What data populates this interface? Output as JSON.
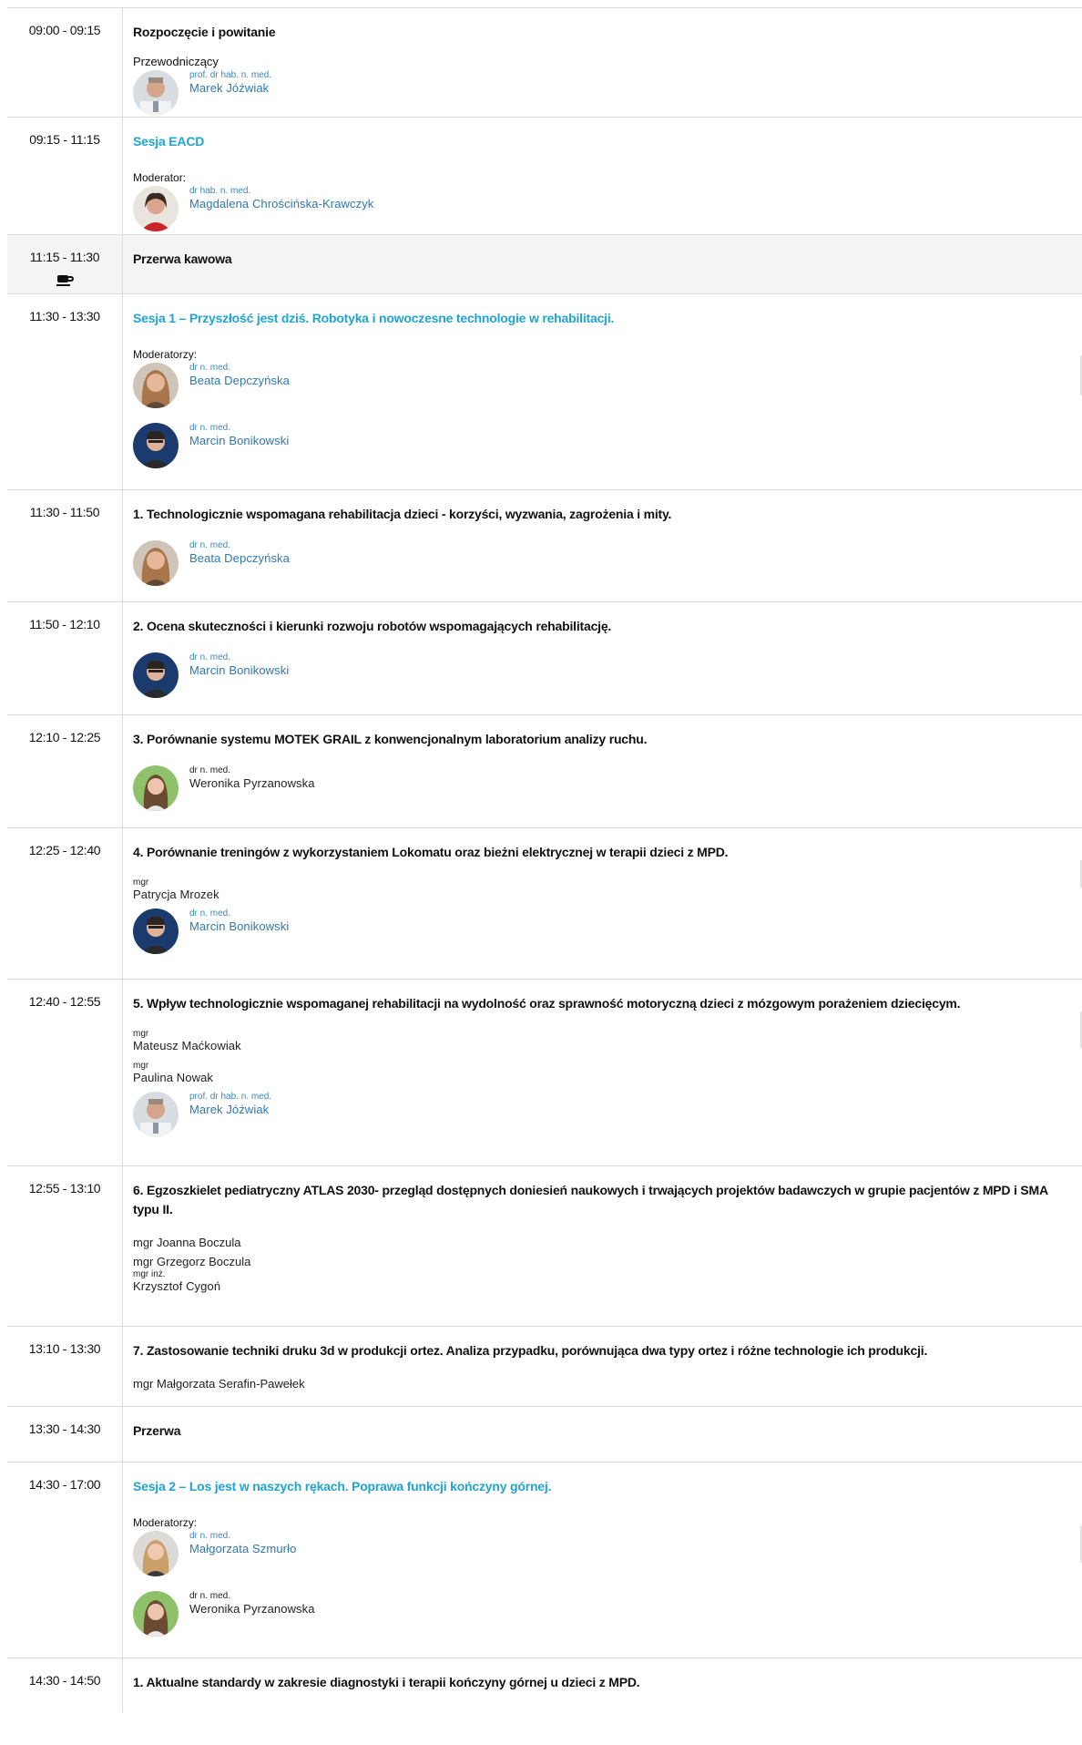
{
  "rows": {
    "r0": {
      "time": "09:00 - 09:15",
      "title": "Rozpoczęcie i powitanie",
      "role": "Przewodniczący",
      "p1": {
        "deg": "prof. dr hab. n. med.",
        "name": "Marek Jóźwiak"
      }
    },
    "r1": {
      "time": "09:15 - 11:15",
      "title": "Sesja EACD",
      "role": "Moderator:",
      "p1": {
        "deg": "dr hab. n. med.",
        "name": "Magdalena Chrościńska-Krawczyk"
      }
    },
    "r2": {
      "time": "11:15 - 11:30",
      "title": "Przerwa kawowa",
      "icon": "coffee-cup-icon"
    },
    "r3": {
      "time": "11:30 - 13:30",
      "title": "Sesja 1 – Przyszłość jest dziś. Robotyka i nowoczesne technologie w rehabilitacji.",
      "role": "Moderatorzy:",
      "p1": {
        "deg": "dr n. med.",
        "name": "Beata Depczyńska"
      },
      "p2": {
        "deg": "dr n. med.",
        "name": "Marcin Bonikowski"
      }
    },
    "r4": {
      "time": "11:30 - 11:50",
      "title": "1. Technologicznie wspomagana rehabilitacja dzieci - korzyści, wyzwania, zagrożenia i mity.",
      "p1": {
        "deg": "dr n. med.",
        "name": "Beata Depczyńska"
      }
    },
    "r5": {
      "time": "11:50 - 12:10",
      "title": "2. Ocena skuteczności i kierunki rozwoju robotów wspomagających rehabilitację.",
      "p1": {
        "deg": "dr n. med.",
        "name": "Marcin Bonikowski"
      }
    },
    "r6": {
      "time": "12:10 - 12:25",
      "title": "3. Porównanie systemu MOTEK GRAIL z konwencjonalnym laboratorium analizy ruchu.",
      "p1": {
        "deg": "dr n. med.",
        "name": "Weronika Pyrzanowska"
      }
    },
    "r7": {
      "time": "12:25 - 12:40",
      "title": "4. Porównanie treningów z wykorzystaniem Lokomatu oraz bieżni elektrycznej w terapii dzieci z MPD.",
      "t1": {
        "deg": "mgr",
        "name": "Patrycja Mrozek"
      },
      "p1": {
        "deg": "dr n. med.",
        "name": "Marcin Bonikowski"
      }
    },
    "r8": {
      "time": "12:40 - 12:55",
      "title": "5. Wpływ technologicznie wspomaganej rehabilitacji na wydolność oraz sprawność motoryczną dzieci z mózgowym porażeniem dziecięcym.",
      "t1": {
        "deg": "mgr",
        "name": "Mateusz Maćkowiak"
      },
      "t2": {
        "deg": "mgr",
        "name": "Paulina Nowak"
      },
      "p1": {
        "deg": "prof. dr hab. n. med.",
        "name": "Marek Jóźwiak"
      }
    },
    "r9": {
      "time": "12:55 - 13:10",
      "title": "6. Egzoszkielet pediatryczny ATLAS 2030- przegląd dostępnych doniesień naukowych i trwających projektów badawczych w grupie pacjentów z MPD i SMA typu II.",
      "s1": "mgr Joanna Boczula",
      "s2": "mgr Grzegorz Boczula",
      "t1": {
        "deg": "mgr inż.",
        "name": "Krzysztof Cygoń"
      }
    },
    "r10": {
      "time": "13:10 - 13:30",
      "title": "7. Zastosowanie techniki druku 3d w produkcji ortez. Analiza przypadku, porównująca dwa typy ortez i różne technologie ich produkcji.",
      "s1": "mgr Małgorzata Serafin-Pawełek"
    },
    "r11": {
      "time": "13:30 - 14:30",
      "title": "Przerwa"
    },
    "r12": {
      "time": "14:30 - 17:00",
      "title": "Sesja 2 – Los jest w naszych rękach. Poprawa funkcji kończyny górnej.",
      "role": "Moderatorzy:",
      "p1": {
        "deg": "dr n. med.",
        "name": "Małgorzata Szmurło"
      },
      "p2": {
        "deg": "dr n. med.",
        "name": "Weronika Pyrzanowska"
      }
    },
    "r13": {
      "time": "14:30 - 14:50",
      "title": "1. Aktualne standardy w zakresie diagnostyki i terapii kończyny górnej u dzieci z MPD."
    }
  },
  "colors": {
    "link": "#1fa4d3",
    "name": "#2f77b0",
    "border": "#dcdcdc",
    "break_bg": "#f4f4f4"
  }
}
